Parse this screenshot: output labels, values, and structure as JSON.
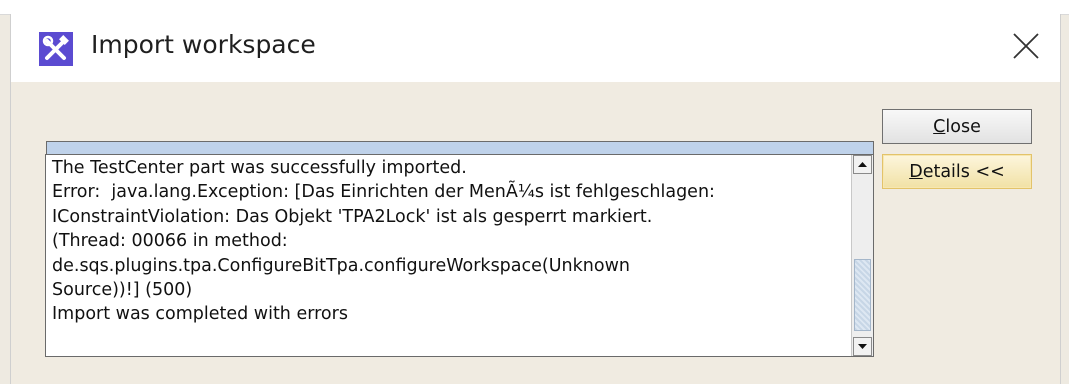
{
  "window": {
    "title": "Import workspace",
    "close_glyph": "X"
  },
  "progress": {
    "fraction": 1.0
  },
  "log": {
    "lines": [
      "The TestCenter part was successfully imported.",
      "Error:  java.lang.Exception: [Das Einrichten der MenÃ¼s ist fehlgeschlagen:",
      "IConstraintViolation: Das Objekt 'TPA2Lock' ist als gesperrt markiert.",
      "(Thread: 00066 in method:",
      "de.sqs.plugins.tpa.ConfigureBitTpa.configureWorkspace(Unknown",
      "Source))!] (500)",
      "Import was completed with errors"
    ]
  },
  "buttons": {
    "close_label": "Close",
    "close_mnemonic": "C",
    "close_rest": "lose",
    "details_label": "Details <<",
    "details_mnemonic": "D",
    "details_rest": "etails <<"
  },
  "icons": {
    "app": "tools-icon",
    "close": "close-icon",
    "scroll_up": "arrow-up-icon",
    "scroll_down": "arrow-down-icon"
  },
  "colors": {
    "app_icon": "#5b4bd1",
    "dialog_bg": "#f0ebe1",
    "progress_fill": "#bfd2ea"
  }
}
